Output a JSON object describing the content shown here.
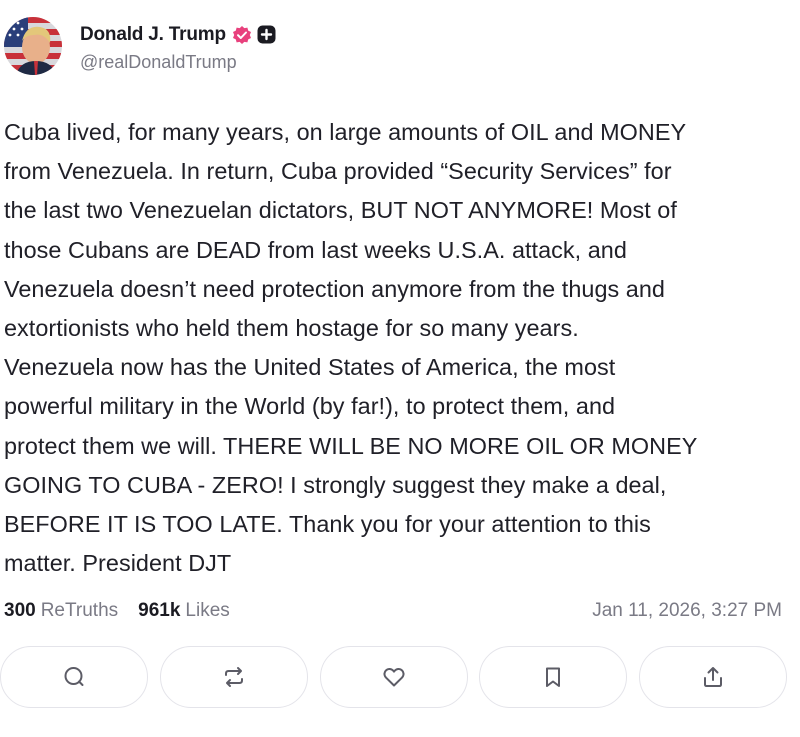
{
  "author": {
    "name": "Donald J. Trump",
    "handle": "@realDonaldTrump",
    "avatar_icon": "avatar-flag-portrait",
    "verified_icon": "verified-badge-icon",
    "verified_color": "#e8417d",
    "plus_icon": "plus-badge-icon"
  },
  "post": {
    "text": "Cuba lived, for many years, on large amounts of OIL and MONEY\nfrom Venezuela. In return, Cuba provided “Security Services” for\nthe last two Venezuelan dictators, BUT NOT ANYMORE! Most of\nthose Cubans are DEAD from last weeks U.S.A. attack, and\nVenezuela doesn’t need protection anymore from the thugs and\nextortionists who held them hostage for so many years.\nVenezuela now has the United States of America, the most\npowerful military in the World (by far!), to protect them, and\nprotect them we will. THERE WILL BE NO MORE OIL OR MONEY\nGOING TO CUBA - ZERO! I strongly suggest they make a deal,\nBEFORE IT IS TOO LATE. Thank you for your attention to this\nmatter. President DJT"
  },
  "stats": {
    "retruths_count": "300",
    "retruths_label": "ReTruths",
    "likes_count": "961k",
    "likes_label": "Likes",
    "timestamp": "Jan 11, 2026, 3:27 PM"
  },
  "actions": [
    {
      "icon": "reply-icon"
    },
    {
      "icon": "retruth-icon"
    },
    {
      "icon": "like-icon"
    },
    {
      "icon": "bookmark-icon"
    },
    {
      "icon": "share-icon"
    }
  ],
  "colors": {
    "text": "#202028",
    "muted": "#7a7a85",
    "border": "#e4e4ea",
    "icon": "#5c5c66"
  }
}
